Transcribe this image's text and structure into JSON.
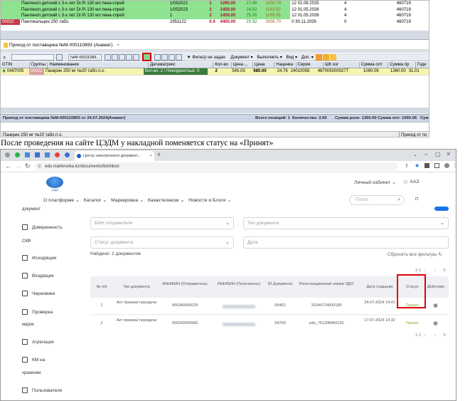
{
  "top_window": {
    "upper_rows": [
      {
        "badge": "",
        "name": "Пантенол детский с 3-х лет Dr.Pi 130 мл пена-спрей",
        "doc": "1/082022",
        "qty": "1",
        "price": "1290.00",
        "pct": "27.88",
        "sum": "1000.74",
        "exp": "12 01.08.2025",
        "q2": "4",
        "code": "460719"
      },
      {
        "badge": "",
        "name": "Пантенол детский с 3-х лет Dr.Pi 130 мл пена-спрей",
        "doc": "1/052023",
        "qty": "2",
        "price": "1450.00",
        "pct": "24.62",
        "sum": "1163.50",
        "exp": "12 01.05.2026",
        "q2": "4",
        "code": "460719"
      },
      {
        "badge": "",
        "name": "Пантенол детский с 3-х лет Dr.Pi 130 мл пена-спрей",
        "doc": "1",
        "qty": "2",
        "price": "1450.00",
        "pct": "25.05",
        "sum": "1159.55",
        "exp": "12 01.05.2026",
        "q2": "4",
        "code": "460719"
      },
      {
        "badge": "00022",
        "name": "Пантокальцин 250 табл.",
        "doc": "2951122",
        "qty": "0.4",
        "price": "4400.00",
        "pct": "20.92",
        "sum": "3636.70",
        "exp": "0 30.11.2026",
        "q2": "0",
        "code": "460719"
      }
    ],
    "window_title": "Приход от поставщика №М-000110893 (Анамат)",
    "doc_field": "№М-00011089...",
    "toolbar": {
      "filter": "Фильтр не задан",
      "document": "Документ",
      "execute": "Выполнить",
      "view": "Вид",
      "extra": "Доп."
    },
    "columns": [
      "GTIN",
      "Группы",
      "Наименование",
      "Датаматрикс",
      "Кол-во",
      "Цена ...",
      "Цена",
      "Наценка",
      "Серия",
      "ШК изг",
      "Сумма опт",
      "Сумма пр",
      "Годе"
    ],
    "row": {
      "gtin": "0487005",
      "group": "00022",
      "name": "Панкрин 250 мг №20 табл.п.о.",
      "dm": "Кол-во: 2 / Некорректных: 0",
      "qty": "2",
      "price1": "545.03",
      "price": "680.00",
      "markup": "24,76",
      "series": "24010058",
      "barcode": "4870050000277",
      "sum_opt": "1090.06",
      "sum_pr": "1360.00",
      "exp": "31.01"
    },
    "status": {
      "left": "Приход от поставщика №М-000110893 от 24.07.2024(Анамат)",
      "positions": "Всего позиций: 1",
      "quantity": "Количество: 2.00",
      "sum_retail": "Сумма розн: 1360.00",
      "sum_opt": "Сумма опт: 1090.06",
      "sum": "Сумма"
    },
    "bottom_left": "Панкрин 250 мг №20 табл.п.о.",
    "bottom_right": "Приход от по"
  },
  "caption": "После проведения на сайте ЦЭДМ у накладной поменяется статус на «Принят»",
  "browser": {
    "tab_title": "Центр электронного документ...",
    "url": "edo.markirovka.kz/documents/list/inbox",
    "logo_text": "ЦЭДМ",
    "cabinet": "Личный кабинет",
    "lang": "КАЗ",
    "nav": [
      "О платформе",
      "Каталог",
      "Маркировка",
      "Казахтелеком",
      "Новости и Блоги"
    ],
    "search_placeholder": "Поиск",
    "sidebar": {
      "doc_label": "документ",
      "items": [
        "Доверенность",
        "Исходящие",
        "Входящие",
        "Черновики",
        "Проверка",
        "Агрегация",
        "КМ на",
        "Пользователи"
      ],
      "extra": [
        "СКФ",
        "марок",
        "хранении"
      ]
    },
    "filters": {
      "bin_sender": "БИН отправителя",
      "doc_type": "Тип документа",
      "doc_status": "Статус документа",
      "date": "Дата"
    },
    "found": "Найдено: 2 документов",
    "reset": "Сбросить все фильтры",
    "table": {
      "headers": [
        "№ п/п",
        "Тип документа",
        "ИНН/БИН (Отправитель)",
        "ИНН/БИН (Получатель)",
        "ID Документа",
        "Регистрационный номер ЭДО",
        "Дата создания",
        "Статус",
        "Действие"
      ],
      "rows": [
        {
          "n": "1",
          "type": "Акт приема/ передачи",
          "sender": "960340000029",
          "receiver": "",
          "id": "69462",
          "reg": "20240724000189",
          "date": "24-07-2024 14:41",
          "status": "Принят"
        },
        {
          "n": "2",
          "type": "Акт приема/ передачи",
          "sender": "050240000960",
          "receiver": "",
          "id": "54700",
          "reg": "edo_751208450120",
          "date": "17-07-2024 14:32",
          "status": "Принят"
        }
      ]
    },
    "pagination": "1-2"
  }
}
